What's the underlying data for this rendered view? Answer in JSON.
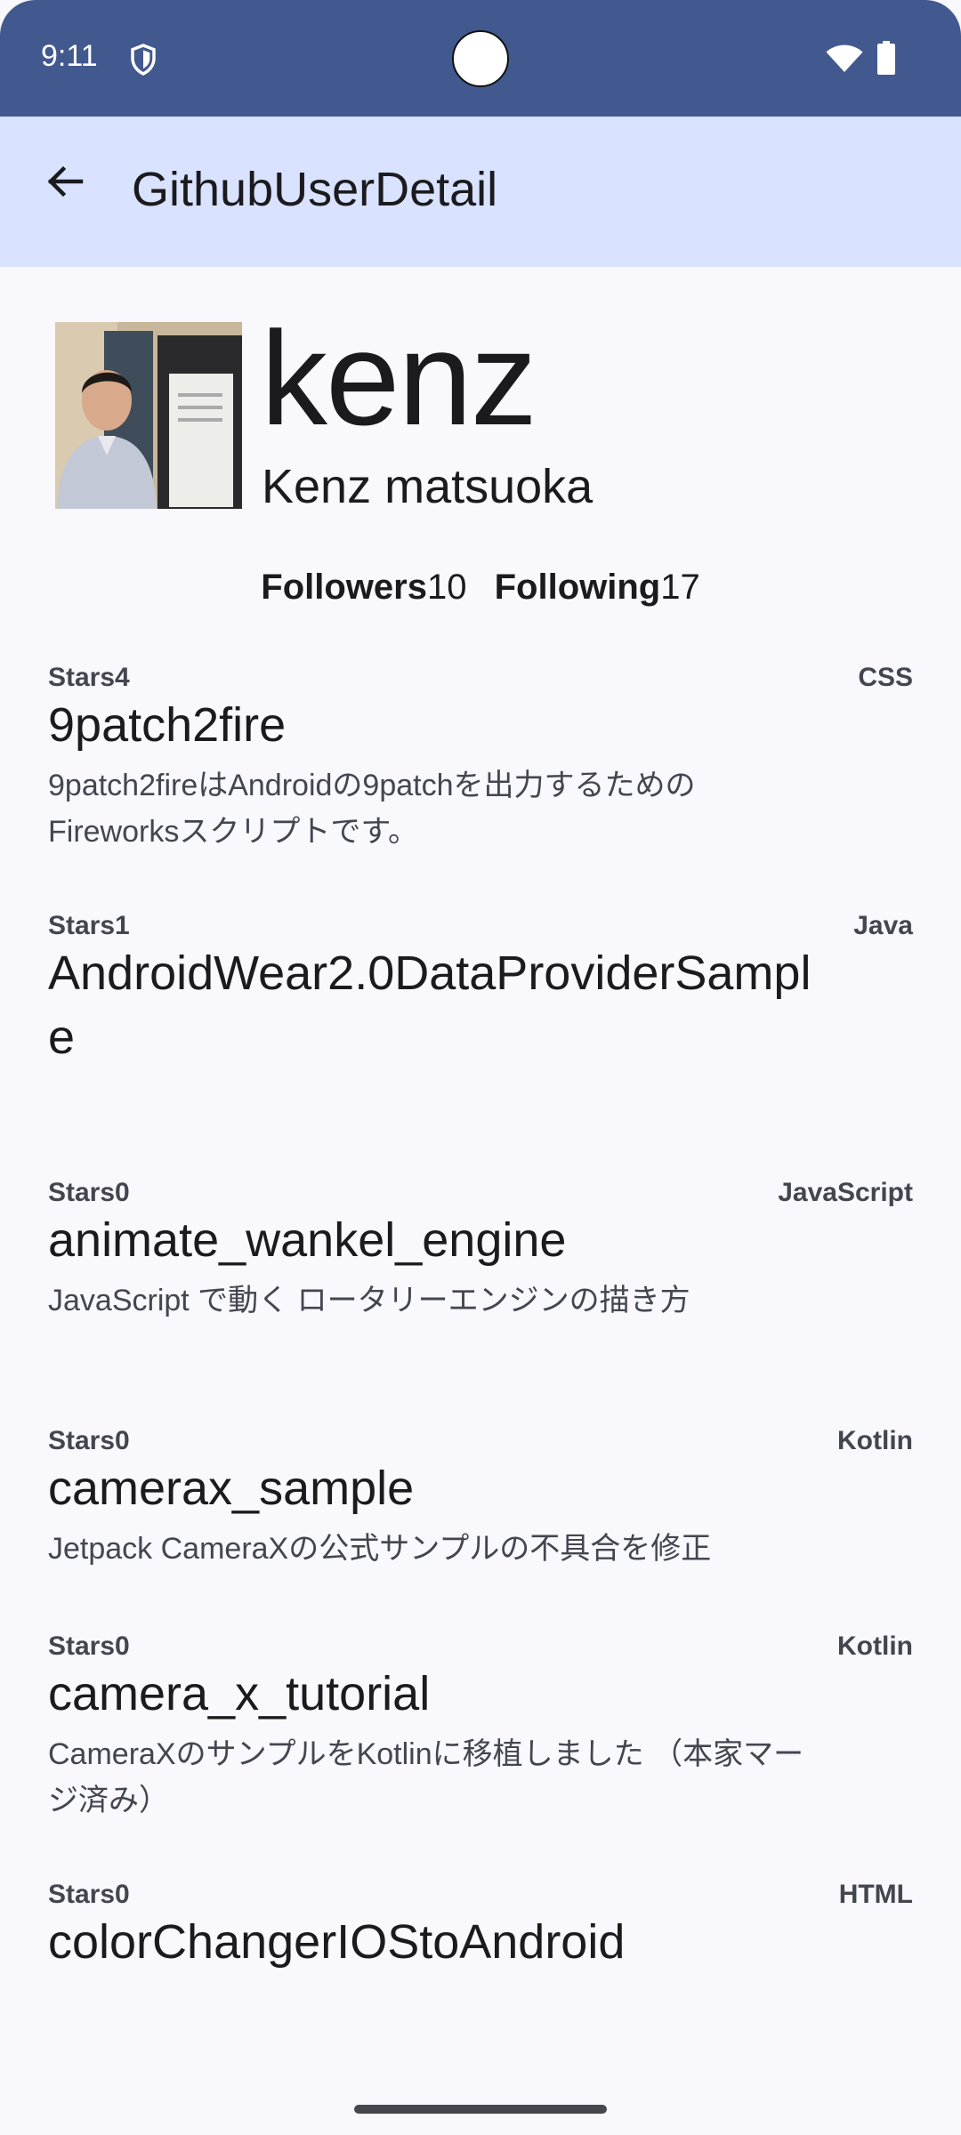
{
  "status_bar": {
    "time": "9:11"
  },
  "app_bar": {
    "title": "GithubUserDetail"
  },
  "profile": {
    "login": "kenz",
    "name": "Kenz matsuoka",
    "followers_label": "Followers",
    "followers_count": "10",
    "following_label": "Following",
    "following_count": "17"
  },
  "repos": [
    {
      "stars": "Stars4",
      "language": "CSS",
      "name": "9patch2fire",
      "description": "9patch2fireはAndroidの9patchを出力するための Fireworksスクリプトです。"
    },
    {
      "stars": "Stars1",
      "language": "Java",
      "name": "AndroidWear2.0DataProviderSample",
      "description": ""
    },
    {
      "stars": "Stars0",
      "language": "JavaScript",
      "name": "animate_wankel_engine",
      "description": "JavaScript で動く ロータリーエンジンの描き方"
    },
    {
      "stars": "Stars0",
      "language": "Kotlin",
      "name": "camerax_sample",
      "description": "Jetpack CameraXの公式サンプルの不具合を修正"
    },
    {
      "stars": "Stars0",
      "language": "Kotlin",
      "name": "camera_x_tutorial",
      "description": "CameraXのサンプルをKotlinに移植しました （本家マージ済み）"
    },
    {
      "stars": "Stars0",
      "language": "HTML",
      "name": "colorChangerIOStoAndroid",
      "description": ""
    }
  ]
}
